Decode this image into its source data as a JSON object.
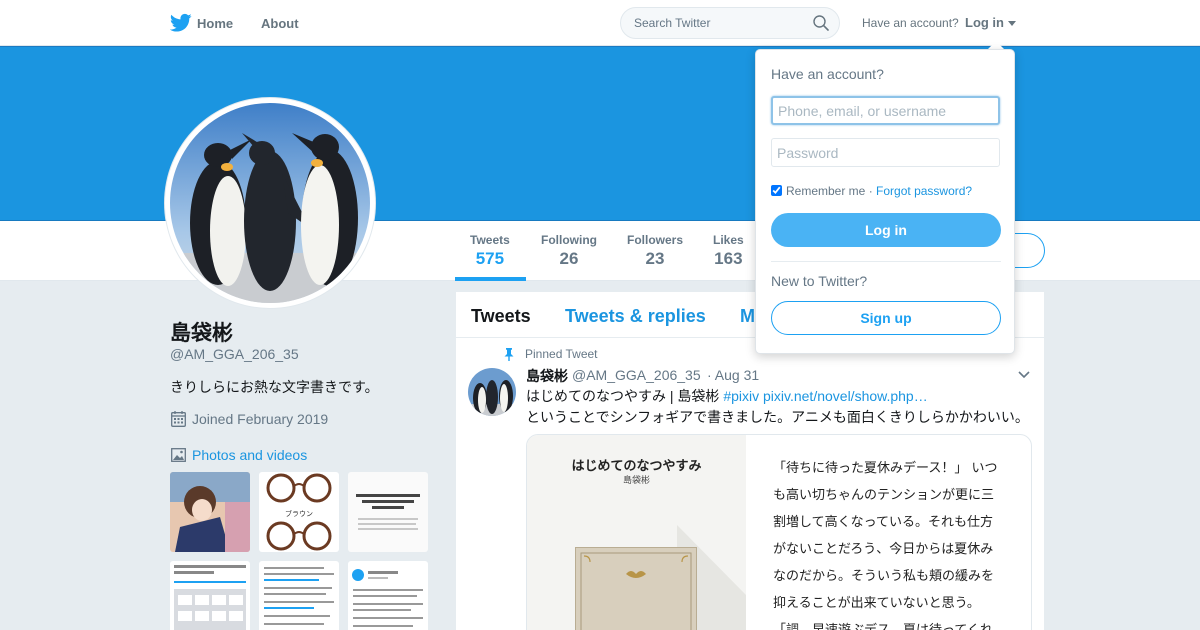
{
  "nav": {
    "home_label": "Home",
    "about_label": "About",
    "search_placeholder": "Search Twitter",
    "have_account": "Have an account?",
    "login_label": "Log in"
  },
  "profile": {
    "name": "島袋彬",
    "handle": "@AM_GGA_206_35",
    "bio": "きりしらにお熱な文字書きです。",
    "joined": "Joined February 2019",
    "photos_label": "Photos and videos"
  },
  "stats": [
    {
      "label": "Tweets",
      "value": "575"
    },
    {
      "label": "Following",
      "value": "26"
    },
    {
      "label": "Followers",
      "value": "23"
    },
    {
      "label": "Likes",
      "value": "163"
    }
  ],
  "timeline": {
    "tabs": [
      "Tweets",
      "Tweets & replies",
      "M"
    ],
    "pinned_label": "Pinned Tweet",
    "tweet": {
      "name": "島袋彬",
      "handle": "@AM_GGA_206_35",
      "date": "· Aug 31",
      "text_line1": "はじめてのなつやすみ | 島袋彬 ",
      "text_link": "#pixiv pixiv.net/novel/show.php…",
      "text_line2": "ということでシンフォギアで書きました。アニメも面白くきりしらかかわいい。"
    },
    "card": {
      "title": "はじめてのなつやすみ",
      "author": "島袋彬",
      "lines": [
        "「待ちに待った夏休みデース！」 いつ",
        "も高い切ちゃんのテンションが更に三",
        "割増して高くなっている。それも仕方",
        "がないことだろう、今日からは夏休み",
        "なのだから。そういう私も頬の緩みを",
        "抑えることが出来ていないと思う。",
        "「調、早速遊ぶデス。夏は待ってくれ"
      ]
    }
  },
  "login_dropdown": {
    "title": "Have an account?",
    "username_placeholder": "Phone, email, or username",
    "password_placeholder": "Password",
    "remember_label": "Remember me",
    "separator": "·",
    "forgot_label": "Forgot password?",
    "login_button": "Log in",
    "new_label": "New to Twitter?",
    "signup_button": "Sign up"
  },
  "colors": {
    "banner": "#1b95e0",
    "accent": "#1da1f2",
    "background": "#e6ecf0"
  }
}
